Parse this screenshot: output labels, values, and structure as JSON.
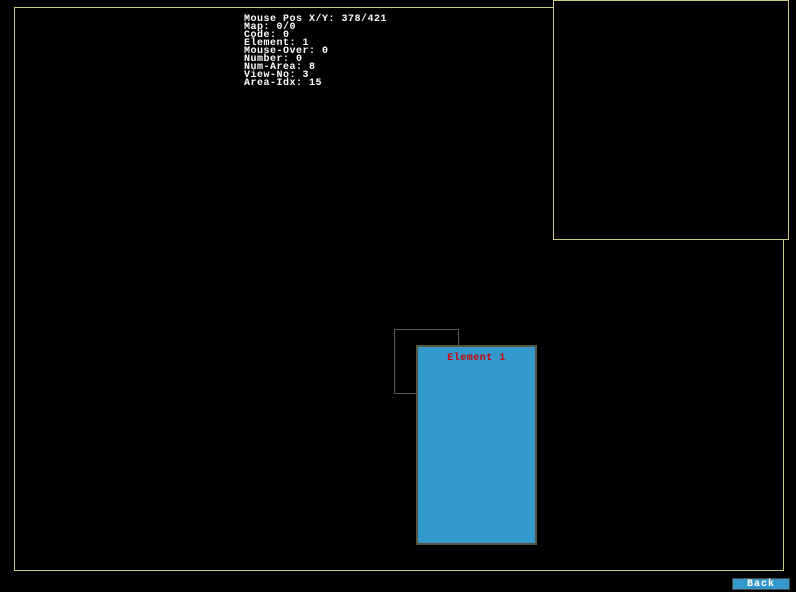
{
  "debug": {
    "mouse_pos_label": "Mouse Pos X/Y:",
    "mouse_pos_value": "378/421",
    "map_label": "Map:",
    "map_value": "0/0",
    "code_label": "Code:",
    "code_value": "0",
    "element_label": "Element:",
    "element_value": "1",
    "mouse_over_label": "Mouse-Over:",
    "mouse_over_value": "0",
    "number_label": "Number:",
    "number_value": "0",
    "num_area_label": "Num-Area:",
    "num_area_value": "8",
    "view_no_label": "View-No:",
    "view_no_value": "3",
    "area_idx_label": "Area-Idx:",
    "area_idx_value": "15"
  },
  "element_box": {
    "label": "Element 1"
  },
  "back_button": {
    "label": "Back"
  }
}
